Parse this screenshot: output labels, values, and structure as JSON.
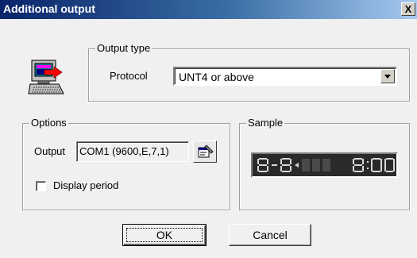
{
  "window": {
    "title": "Additional output",
    "close_label": "X"
  },
  "output_type": {
    "group_label": "Output type",
    "protocol_label": "Protocol",
    "protocol_value": "UNT4 or above"
  },
  "options": {
    "group_label": "Options",
    "output_label": "Output",
    "output_value": "COM1 (9600,E,7,1)",
    "display_period_label": "Display period",
    "display_period_checked": false
  },
  "sample": {
    "group_label": "Sample"
  },
  "buttons": {
    "ok_label": "OK",
    "cancel_label": "Cancel"
  },
  "colors": {
    "title_bar": "#0a246a",
    "display_bg": "#2a2a2a",
    "display_segment": "#d8d8d8"
  }
}
